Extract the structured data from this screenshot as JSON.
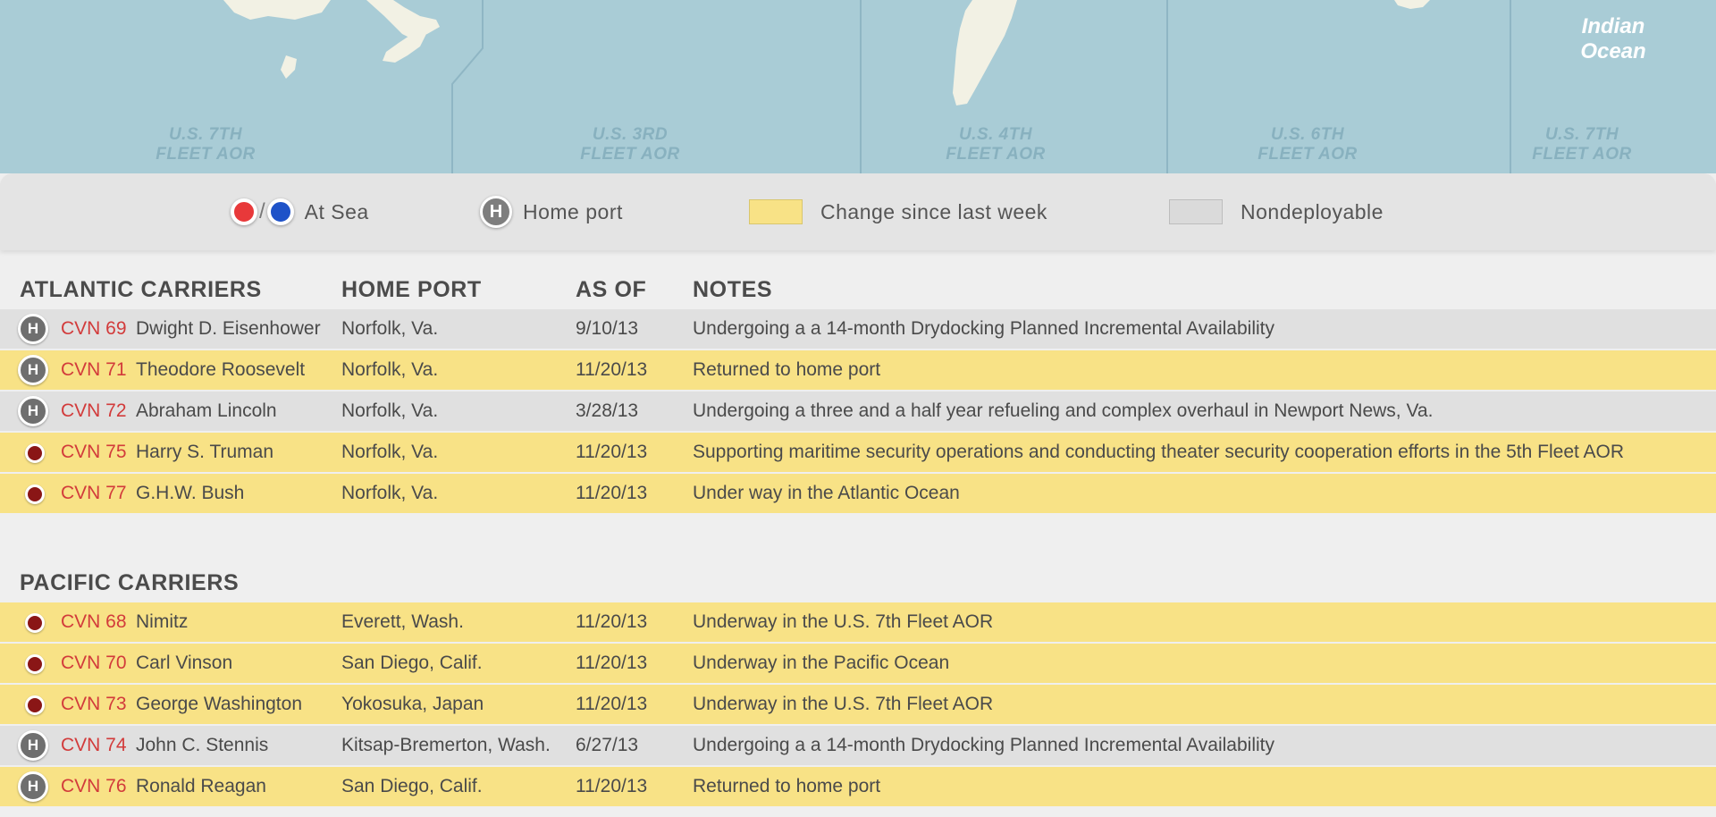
{
  "map": {
    "ocean_label": "Indian Ocean",
    "fleet_labels": [
      {
        "line1": "U.S. 7TH",
        "line2": "FLEET AOR"
      },
      {
        "line1": "U.S. 3RD",
        "line2": "FLEET AOR"
      },
      {
        "line1": "U.S. 4TH",
        "line2": "FLEET AOR"
      },
      {
        "line1": "U.S. 6TH",
        "line2": "FLEET AOR"
      },
      {
        "line1": "U.S. 7TH",
        "line2": "FLEET AOR"
      }
    ]
  },
  "legend": {
    "at_sea": "At Sea",
    "home_port": "Home port",
    "change": "Change since last week",
    "nondeployable": "Nondeployable",
    "home_badge": "H",
    "slash": "/"
  },
  "atlantic": {
    "title": "ATLANTIC CARRIERS",
    "col_port": "HOME PORT",
    "col_asof": "AS OF",
    "col_notes": "NOTES",
    "rows": [
      {
        "status": "home",
        "highlight": "nondeploy",
        "cvn": "CVN 69",
        "name": "Dwight D. Eisenhower",
        "port": "Norfolk, Va.",
        "date": "9/10/13",
        "note": "Undergoing a a 14-month Drydocking Planned Incremental Availability"
      },
      {
        "status": "home",
        "highlight": "change",
        "cvn": "CVN 71",
        "name": "Theodore Roosevelt",
        "port": "Norfolk, Va.",
        "date": "11/20/13",
        "note": "Returned to home port"
      },
      {
        "status": "home",
        "highlight": "nondeploy",
        "cvn": "CVN 72",
        "name": "Abraham Lincoln",
        "port": "Norfolk, Va.",
        "date": "3/28/13",
        "note": "Undergoing a three and a half year refueling and complex overhaul in Newport News, Va."
      },
      {
        "status": "sea",
        "highlight": "change",
        "cvn": "CVN 75",
        "name": "Harry S. Truman",
        "port": "Norfolk, Va.",
        "date": "11/20/13",
        "note": "Supporting maritime security operations and conducting theater security cooperation efforts in the 5th Fleet AOR"
      },
      {
        "status": "sea",
        "highlight": "change",
        "cvn": "CVN 77",
        "name": "G.H.W. Bush",
        "port": "Norfolk, Va.",
        "date": "11/20/13",
        "note": "Under way in the Atlantic Ocean"
      }
    ]
  },
  "pacific": {
    "title": "PACIFIC CARRIERS",
    "rows": [
      {
        "status": "sea",
        "highlight": "change",
        "cvn": "CVN 68",
        "name": "Nimitz",
        "port": "Everett, Wash.",
        "date": "11/20/13",
        "note": "Underway in the U.S. 7th Fleet AOR"
      },
      {
        "status": "sea",
        "highlight": "change",
        "cvn": "CVN 70",
        "name": "Carl Vinson",
        "port": "San Diego, Calif.",
        "date": "11/20/13",
        "note": "Underway in the Pacific Ocean"
      },
      {
        "status": "sea",
        "highlight": "change",
        "cvn": "CVN 73",
        "name": "George Washington",
        "port": "Yokosuka, Japan",
        "date": "11/20/13",
        "note": "Underway in the U.S. 7th Fleet AOR"
      },
      {
        "status": "home",
        "highlight": "nondeploy",
        "cvn": "CVN 74",
        "name": "John C. Stennis",
        "port": "Kitsap-Bremerton, Wash.",
        "date": "6/27/13",
        "note": "Undergoing a a 14-month Drydocking Planned Incremental Availability"
      },
      {
        "status": "home",
        "highlight": "change",
        "cvn": "CVN 76",
        "name": "Ronald Reagan",
        "port": "San Diego, Calif.",
        "date": "11/20/13",
        "note": "Returned to home port"
      }
    ]
  },
  "colors": {
    "ocean": "#a9ccd6",
    "land": "#f2f1e4",
    "change_highlight": "#f8e286",
    "nondeployable": "#e0e0e0",
    "hull_number": "#d23b3b",
    "at_sea_red": "#e8393a",
    "at_sea_blue": "#1e52c8"
  }
}
